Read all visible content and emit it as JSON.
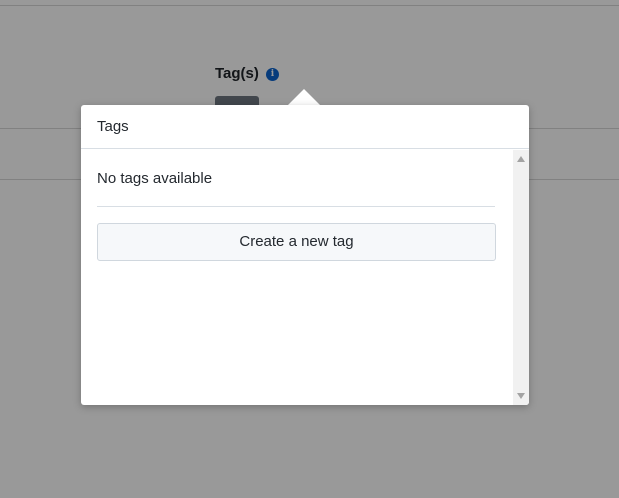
{
  "form": {
    "field_label": "Tag(s)",
    "info_icon": "info-icon"
  },
  "popover": {
    "title": "Tags",
    "empty_message": "No tags available",
    "create_button_label": "Create a new tag"
  },
  "colors": {
    "overlay": "rgba(0,0,0,0.40)",
    "info_icon": "#0b63ce",
    "button_background": "#f6f8fa",
    "button_border": "#d0d7de"
  }
}
